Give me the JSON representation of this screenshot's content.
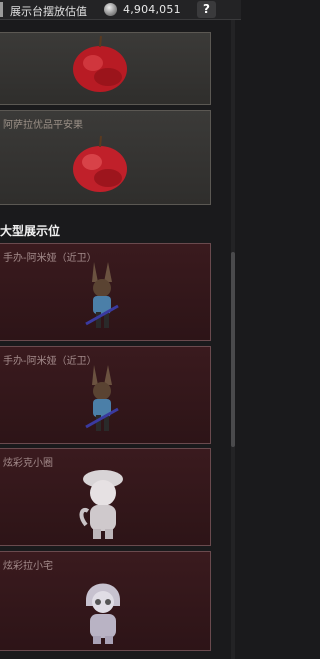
{
  "topbar": {
    "title": "展示台摆放估值",
    "amount": "4,904,051",
    "help_label": "?"
  },
  "small_items": [
    {
      "label": "",
      "icon": "apple"
    },
    {
      "label": "阿萨拉优品平安果",
      "icon": "apple"
    }
  ],
  "large_section": {
    "title": "大型展示位",
    "items": [
      {
        "label": "手办-阿米娅（近卫）",
        "icon": "amiya-figure"
      },
      {
        "label": "手办-阿米娅（近卫）",
        "icon": "amiya-figure"
      },
      {
        "label": "炫彩克小圈",
        "icon": "chibi-hat-figure"
      },
      {
        "label": "炫彩拉小宅",
        "icon": "chibi-hood-figure"
      }
    ]
  },
  "colors": {
    "gray_card": "#3b3a38",
    "maroon_card": "#3a1a1e",
    "apple_red": "#c8202a"
  }
}
